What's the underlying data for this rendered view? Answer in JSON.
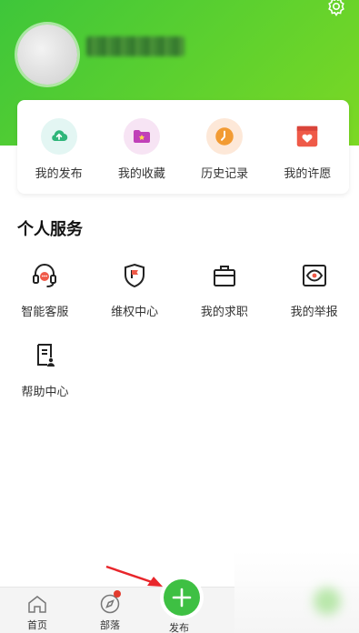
{
  "header": {
    "settings_icon": "gear-icon"
  },
  "quick_actions": [
    {
      "label": "我的发布",
      "icon": "upload-cloud-icon",
      "bg": "#e3f6f3",
      "color": "#2fb67a"
    },
    {
      "label": "我的收藏",
      "icon": "star-folder-icon",
      "bg": "#f7e4f4",
      "color": "#c040b8"
    },
    {
      "label": "历史记录",
      "icon": "clock-icon",
      "bg": "#fde8d8",
      "color": "#f29b33"
    },
    {
      "label": "我的许愿",
      "icon": "heart-card-icon",
      "bg": "#ffffff",
      "color": "#ef5a48"
    }
  ],
  "services": {
    "title": "个人服务",
    "items": [
      {
        "label": "智能客服",
        "icon": "customer-service-icon"
      },
      {
        "label": "维权中心",
        "icon": "shield-flag-icon"
      },
      {
        "label": "我的求职",
        "icon": "briefcase-icon"
      },
      {
        "label": "我的举报",
        "icon": "eye-report-icon"
      },
      {
        "label": "帮助中心",
        "icon": "help-document-icon"
      }
    ]
  },
  "tabbar": {
    "items": [
      {
        "label": "首页",
        "icon": "home-icon"
      },
      {
        "label": "部落",
        "icon": "compass-icon"
      },
      {
        "label": "发布",
        "icon": "plus-icon"
      }
    ],
    "accent": "#3ec043",
    "badge_color": "#e23b2e"
  }
}
